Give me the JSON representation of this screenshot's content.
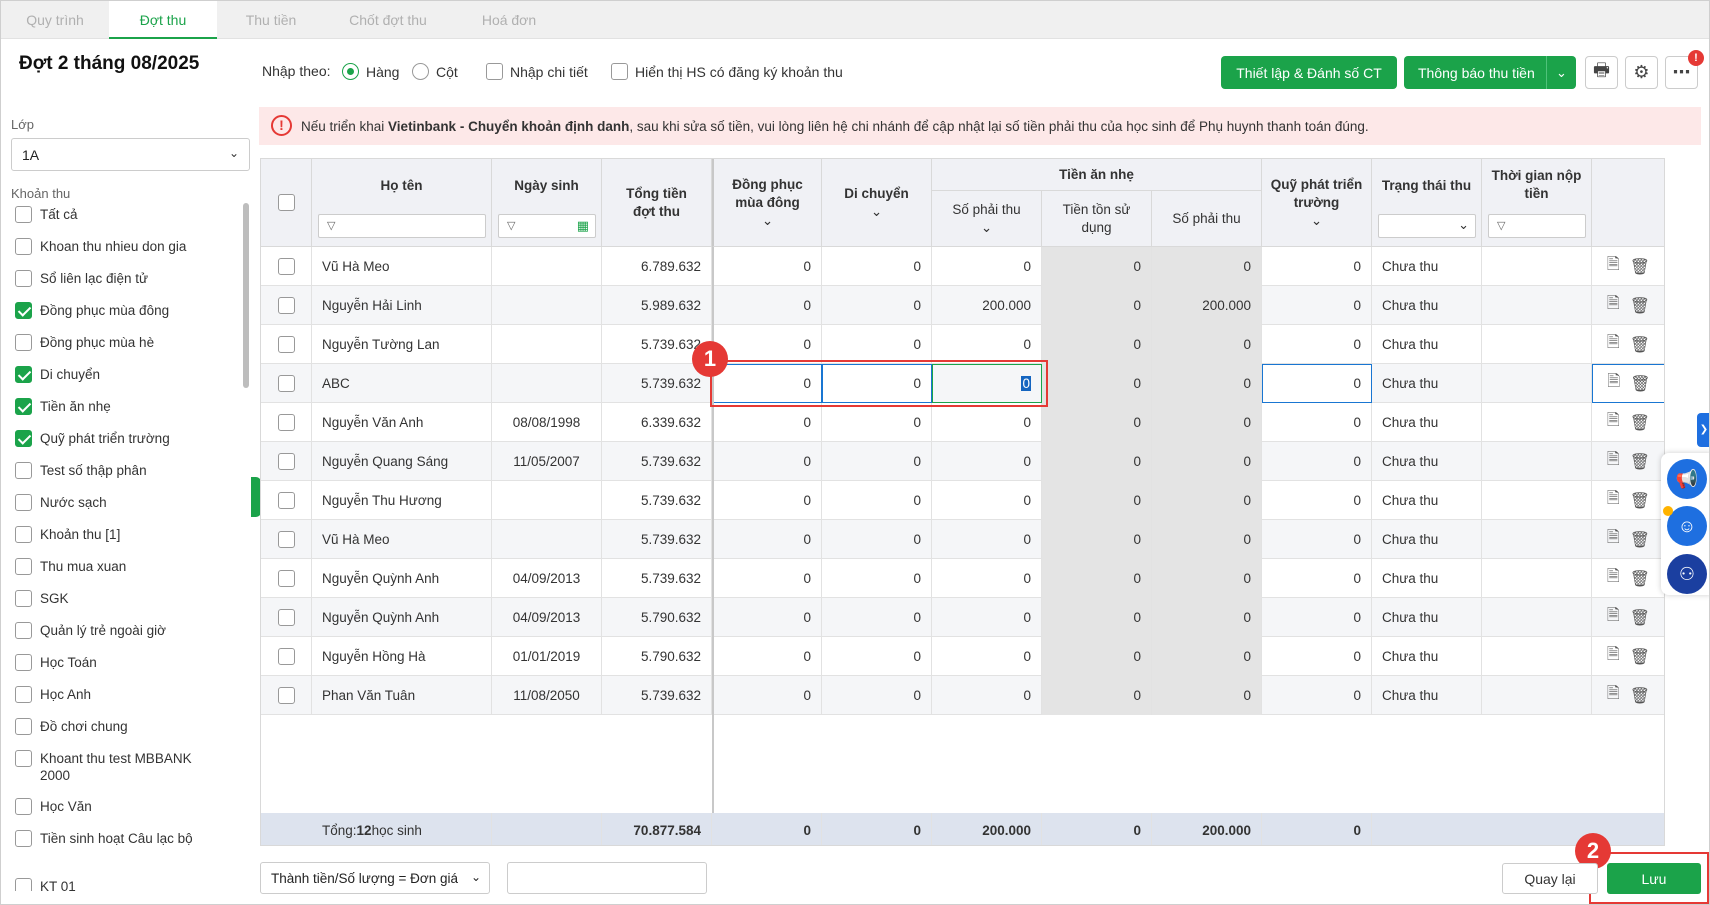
{
  "tabs": [
    {
      "label": "Quy trình"
    },
    {
      "label": "Đợt thu"
    },
    {
      "label": "Thu tiền"
    },
    {
      "label": "Chốt đợt thu"
    },
    {
      "label": "Hoá đơn"
    }
  ],
  "page_title": "Đợt 2 tháng 08/2025",
  "input_mode": {
    "label": "Nhập theo:",
    "row": "Hàng",
    "col": "Cột",
    "detail": "Nhập chi tiết",
    "show_registered": "Hiển thị HS có đăng ký khoản thu"
  },
  "toolbar": {
    "setup": "Thiết lập & Đánh số CT",
    "notify": "Thông báo thu tiền",
    "badge": "!"
  },
  "sidebar": {
    "class_label": "Lớp",
    "class_value": "1A",
    "fees_label": "Khoản thu",
    "items": [
      {
        "label": "Tất cả",
        "checked": false
      },
      {
        "label": "Khoan thu nhieu don gia",
        "checked": false
      },
      {
        "label": "Sổ liên lạc điện tử",
        "checked": false
      },
      {
        "label": "Đồng phục mùa đông",
        "checked": true
      },
      {
        "label": "Đồng phục mùa hè",
        "checked": false
      },
      {
        "label": "Di chuyển",
        "checked": true
      },
      {
        "label": "Tiền ăn nhẹ",
        "checked": true
      },
      {
        "label": "Quỹ phát triển trường",
        "checked": true
      },
      {
        "label": "Test số thập phân",
        "checked": false
      },
      {
        "label": "Nước sạch",
        "checked": false
      },
      {
        "label": "Khoản thu [1]",
        "checked": false
      },
      {
        "label": "Thu mua xuan",
        "checked": false
      },
      {
        "label": "SGK",
        "checked": false
      },
      {
        "label": "Quản lý trẻ ngoài giờ",
        "checked": false
      },
      {
        "label": "Học Toán",
        "checked": false
      },
      {
        "label": "Học Anh",
        "checked": false
      },
      {
        "label": "Đồ chơi chung",
        "checked": false
      },
      {
        "label": "Khoant thu test MBBANK 2000",
        "checked": false
      },
      {
        "label": "Học Văn",
        "checked": false
      },
      {
        "label": "Tiền sinh hoạt Câu lạc bộ",
        "checked": false
      },
      {
        "label": "KT 01",
        "checked": false
      }
    ]
  },
  "alert": {
    "pre": "Nếu triển khai ",
    "bold": "Vietinbank - Chuyển khoản định danh",
    "post": ", sau khi sửa số tiền, vui lòng liên hệ chi nhánh để cập nhật lại số tiền phải thu của học sinh để Phụ huynh thanh toán đúng."
  },
  "table": {
    "headers": {
      "name": "Họ tên",
      "dob": "Ngày sinh",
      "total": "Tổng tiền đợt thu",
      "uniform": "Đồng phục mùa đông",
      "transport": "Di chuyển",
      "snack": "Tiền ăn nhẹ",
      "snack_due": "Số phải thu",
      "snack_used": "Tiền tồn sử dụng",
      "snack_due2": "Số phải thu",
      "fund": "Quỹ phát triển trường",
      "status": "Trạng thái thu",
      "paytime": "Thời gian nộp tiền"
    },
    "rows": [
      {
        "name": "Vũ Hà Meo",
        "dob": "",
        "total": "6.789.632",
        "uniform": "0",
        "transport": "0",
        "due": "0",
        "used": "0",
        "due2": "0",
        "fund": "0",
        "status": "Chưa thu"
      },
      {
        "name": "Nguyễn Hải Linh",
        "dob": "",
        "total": "5.989.632",
        "uniform": "0",
        "transport": "0",
        "due": "200.000",
        "used": "0",
        "due2": "200.000",
        "fund": "0",
        "status": "Chưa thu"
      },
      {
        "name": "Nguyễn Tường Lan",
        "dob": "",
        "total": "5.739.632",
        "uniform": "0",
        "transport": "0",
        "due": "0",
        "used": "0",
        "due2": "0",
        "fund": "0",
        "status": "Chưa thu"
      },
      {
        "name": "ABC",
        "dob": "",
        "total": "5.739.632",
        "uniform": "0",
        "transport": "0",
        "due": "0",
        "used": "0",
        "due2": "0",
        "fund": "0",
        "status": "Chưa thu"
      },
      {
        "name": "Nguyễn Văn Anh",
        "dob": "08/08/1998",
        "total": "6.339.632",
        "uniform": "0",
        "transport": "0",
        "due": "0",
        "used": "0",
        "due2": "0",
        "fund": "0",
        "status": "Chưa thu"
      },
      {
        "name": "Nguyễn Quang Sáng",
        "dob": "11/05/2007",
        "total": "5.739.632",
        "uniform": "0",
        "transport": "0",
        "due": "0",
        "used": "0",
        "due2": "0",
        "fund": "0",
        "status": "Chưa thu"
      },
      {
        "name": "Nguyễn Thu Hương",
        "dob": "",
        "total": "5.739.632",
        "uniform": "0",
        "transport": "0",
        "due": "0",
        "used": "0",
        "due2": "0",
        "fund": "0",
        "status": "Chưa thu"
      },
      {
        "name": "Vũ Hà Meo",
        "dob": "",
        "total": "5.739.632",
        "uniform": "0",
        "transport": "0",
        "due": "0",
        "used": "0",
        "due2": "0",
        "fund": "0",
        "status": "Chưa thu"
      },
      {
        "name": "Nguyễn Quỳnh Anh",
        "dob": "04/09/2013",
        "total": "5.739.632",
        "uniform": "0",
        "transport": "0",
        "due": "0",
        "used": "0",
        "due2": "0",
        "fund": "0",
        "status": "Chưa thu"
      },
      {
        "name": "Nguyễn Quỳnh Anh",
        "dob": "04/09/2013",
        "total": "5.790.632",
        "uniform": "0",
        "transport": "0",
        "due": "0",
        "used": "0",
        "due2": "0",
        "fund": "0",
        "status": "Chưa thu"
      },
      {
        "name": "Nguyễn Hồng Hà",
        "dob": "01/01/2019",
        "total": "5.790.632",
        "uniform": "0",
        "transport": "0",
        "due": "0",
        "used": "0",
        "due2": "0",
        "fund": "0",
        "status": "Chưa thu"
      },
      {
        "name": "Phan Văn Tuân",
        "dob": "11/08/2050",
        "total": "5.739.632",
        "uniform": "0",
        "transport": "0",
        "due": "0",
        "used": "0",
        "due2": "0",
        "fund": "0",
        "status": "Chưa thu"
      }
    ],
    "footer": {
      "label_pre": "Tổng: ",
      "count": "12",
      "label_post": " học sinh",
      "total": "70.877.584",
      "uniform": "0",
      "transport": "0",
      "due": "200.000",
      "used": "0",
      "due2": "200.000",
      "fund": "0"
    }
  },
  "bottom": {
    "formula": "Thành tiền/Số lượng = Đơn giá",
    "back": "Quay lại",
    "save": "Lưu"
  },
  "markers": {
    "m1": "1",
    "m2": "2"
  },
  "colors": {
    "accent": "#1ba34a",
    "alert": "#e53935"
  }
}
